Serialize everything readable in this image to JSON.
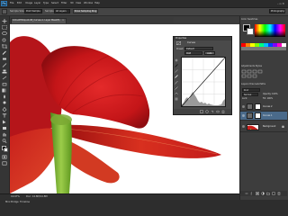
{
  "app": {
    "logo": "Ps"
  },
  "menu": [
    "File",
    "Edit",
    "Image",
    "Layer",
    "Type",
    "Select",
    "Filter",
    "3D",
    "View",
    "Window",
    "Help"
  ],
  "window_controls": "– ▫ ✕",
  "options_bar": {
    "sample_size_label": "Sample Size:",
    "sample_size_value": "Point Sample",
    "sample_label": "Sample:",
    "sample_value": "All Layers",
    "show_ring": "Show Sampling Ring",
    "workspace": "Photography"
  },
  "document": {
    "tab_label": "100-ARTCliquot-08_Curves-1, Layer Mask/8)",
    "close": "×",
    "zoom": "16.67%",
    "doc_size": "Doc: 14.8M/14.8M"
  },
  "properties": {
    "panel_title": "Properties",
    "subtitle": "Curves",
    "preset_label": "Preset:",
    "preset_value": "Default",
    "channel_value": "RGB",
    "auto_label": "Auto"
  },
  "color_panel": {
    "tabs": "Color   Swatches"
  },
  "adjustments_panel": {
    "tabs": "Adjustments   Styles"
  },
  "layers_panel": {
    "tabs": "Layers   Channels   Paths",
    "kind": "Kind",
    "blend_mode": "Normal",
    "opacity": "Opacity: 100%",
    "lock": "Lock:",
    "fill": "Fill: 100%",
    "layers": [
      {
        "name": "Curves 2"
      },
      {
        "name": "Curves 1"
      },
      {
        "name": "Background"
      }
    ]
  },
  "bottom": {
    "mini_bridge": "Mini Bridge",
    "timeline": "Timeline"
  },
  "colors": {
    "app_bg": "#3c3c3c",
    "petal_red": "#d41f24",
    "stem_green": "#7db83a",
    "ps_blue": "#2e7ab8"
  }
}
